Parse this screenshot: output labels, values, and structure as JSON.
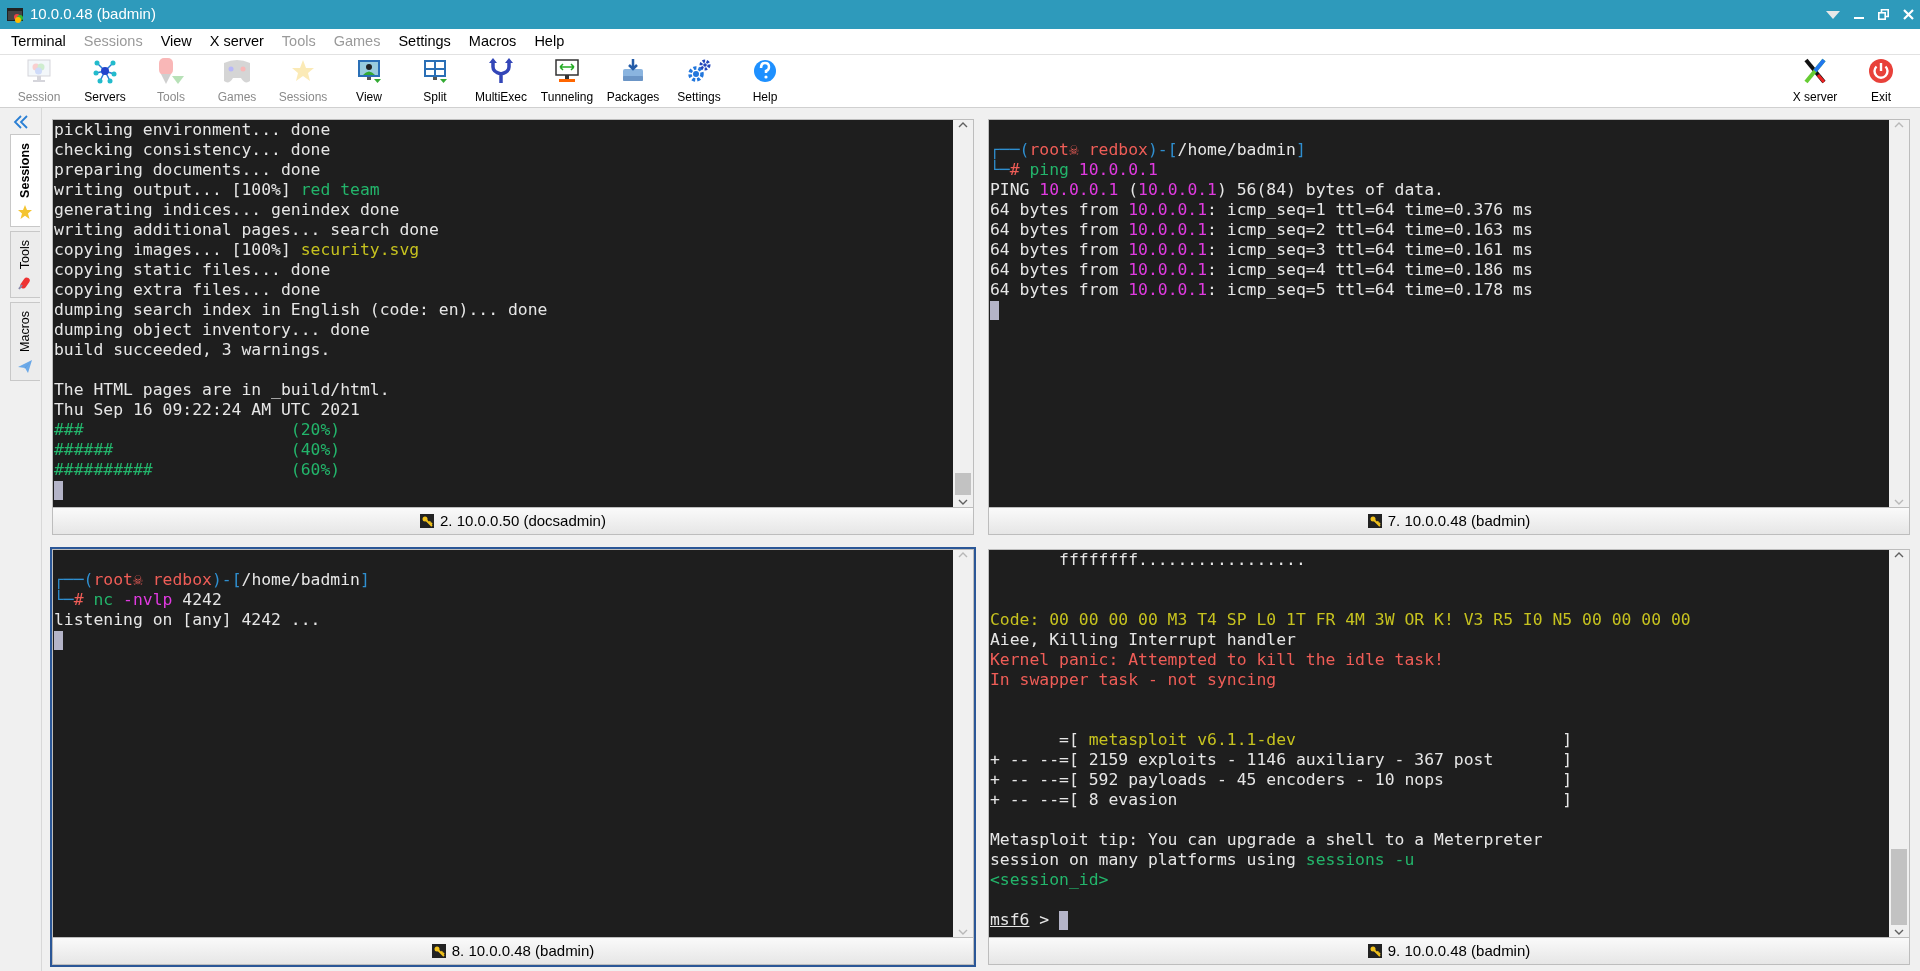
{
  "window": {
    "title": "10.0.0.48 (badmin)"
  },
  "menu": [
    {
      "label": "Terminal",
      "disabled": false
    },
    {
      "label": "Sessions",
      "disabled": true
    },
    {
      "label": "View",
      "disabled": false
    },
    {
      "label": "X server",
      "disabled": false
    },
    {
      "label": "Tools",
      "disabled": true
    },
    {
      "label": "Games",
      "disabled": true
    },
    {
      "label": "Settings",
      "disabled": false
    },
    {
      "label": "Macros",
      "disabled": false
    },
    {
      "label": "Help",
      "disabled": false
    }
  ],
  "toolbar": [
    {
      "label": "Session",
      "disabled": true
    },
    {
      "label": "Servers",
      "disabled": false
    },
    {
      "label": "Tools",
      "disabled": true
    },
    {
      "label": "Games",
      "disabled": true
    },
    {
      "label": "Sessions",
      "disabled": true
    },
    {
      "label": "View",
      "disabled": false
    },
    {
      "label": "Split",
      "disabled": false
    },
    {
      "label": "MultiExec",
      "disabled": false
    },
    {
      "label": "Tunneling",
      "disabled": false
    },
    {
      "label": "Packages",
      "disabled": false
    },
    {
      "label": "Settings",
      "disabled": false
    },
    {
      "label": "Help",
      "disabled": false
    }
  ],
  "toolbar_right": [
    {
      "label": "X server",
      "disabled": false
    },
    {
      "label": "Exit",
      "disabled": false
    }
  ],
  "sidebar": {
    "tabs": [
      {
        "label": "Sessions",
        "selected": true
      },
      {
        "label": "Tools",
        "selected": false
      },
      {
        "label": "Macros",
        "selected": false
      }
    ]
  },
  "panes": [
    {
      "caption": "2. 10.0.0.50 (docsadmin)",
      "selected": false,
      "scrollable": true,
      "lines": [
        {
          "kind": "text",
          "segments": [
            {
              "kind": "plain",
              "text": "pickling environment... done"
            }
          ]
        },
        {
          "kind": "text",
          "segments": [
            {
              "kind": "plain",
              "text": "checking consistency... done"
            }
          ]
        },
        {
          "kind": "text",
          "segments": [
            {
              "kind": "plain",
              "text": "preparing documents... done"
            }
          ]
        },
        {
          "kind": "text",
          "segments": [
            {
              "kind": "plain",
              "text": "writing output... [100%] "
            },
            {
              "kind": "green",
              "text": "red team"
            }
          ]
        },
        {
          "kind": "text",
          "segments": [
            {
              "kind": "plain",
              "text": "generating indices... genindex done"
            }
          ]
        },
        {
          "kind": "text",
          "segments": [
            {
              "kind": "plain",
              "text": "writing additional pages... search done"
            }
          ]
        },
        {
          "kind": "text",
          "segments": [
            {
              "kind": "plain",
              "text": "copying images... [100%] "
            },
            {
              "kind": "yellow",
              "text": "security.svg"
            }
          ]
        },
        {
          "kind": "text",
          "segments": [
            {
              "kind": "plain",
              "text": "copying static files... done"
            }
          ]
        },
        {
          "kind": "text",
          "segments": [
            {
              "kind": "plain",
              "text": "copying extra files... done"
            }
          ]
        },
        {
          "kind": "text",
          "segments": [
            {
              "kind": "plain",
              "text": "dumping search index in English (code: en)... done"
            }
          ]
        },
        {
          "kind": "text",
          "segments": [
            {
              "kind": "plain",
              "text": "dumping object inventory... done"
            }
          ]
        },
        {
          "kind": "text",
          "segments": [
            {
              "kind": "plain",
              "text": "build succeeded, 3 warnings."
            }
          ]
        },
        {
          "kind": "blank"
        },
        {
          "kind": "text",
          "segments": [
            {
              "kind": "plain",
              "text": "The HTML pages are in _build/html."
            }
          ]
        },
        {
          "kind": "text",
          "segments": [
            {
              "kind": "plain",
              "text": "Thu Sep 16 09:22:24 AM UTC 2021"
            }
          ]
        },
        {
          "kind": "text",
          "segments": [
            {
              "kind": "green",
              "text": "###                     (20%)"
            }
          ]
        },
        {
          "kind": "text",
          "segments": [
            {
              "kind": "green",
              "text": "######                  (40%)"
            }
          ]
        },
        {
          "kind": "text",
          "segments": [
            {
              "kind": "green",
              "text": "##########              (60%)"
            }
          ]
        },
        {
          "kind": "cursor"
        }
      ]
    },
    {
      "caption": "7. 10.0.0.48 (badmin)",
      "selected": false,
      "scrollable": false,
      "lines": [
        {
          "kind": "blank"
        },
        {
          "kind": "text",
          "segments": [
            {
              "kind": "blue",
              "text": "┌──("
            },
            {
              "kind": "red",
              "text": "root☠ redbox"
            },
            {
              "kind": "blue",
              "text": ")-["
            },
            {
              "kind": "plain",
              "text": "/home/badmin"
            },
            {
              "kind": "blue",
              "text": "]"
            }
          ]
        },
        {
          "kind": "text",
          "segments": [
            {
              "kind": "blue",
              "text": "└─"
            },
            {
              "kind": "red",
              "text": "# "
            },
            {
              "kind": "green",
              "text": "ping "
            },
            {
              "kind": "magenta",
              "text": "10.0.0.1"
            }
          ]
        },
        {
          "kind": "text",
          "segments": [
            {
              "kind": "plain",
              "text": "PING "
            },
            {
              "kind": "magenta",
              "text": "10.0.0.1"
            },
            {
              "kind": "plain",
              "text": " ("
            },
            {
              "kind": "magenta",
              "text": "10.0.0.1"
            },
            {
              "kind": "plain",
              "text": ") 56(84) bytes of data."
            }
          ]
        },
        {
          "kind": "text",
          "segments": [
            {
              "kind": "plain",
              "text": "64 bytes from "
            },
            {
              "kind": "magenta",
              "text": "10.0.0.1"
            },
            {
              "kind": "plain",
              "text": ": icmp_seq=1 ttl=64 time=0.376 ms"
            }
          ]
        },
        {
          "kind": "text",
          "segments": [
            {
              "kind": "plain",
              "text": "64 bytes from "
            },
            {
              "kind": "magenta",
              "text": "10.0.0.1"
            },
            {
              "kind": "plain",
              "text": ": icmp_seq=2 ttl=64 time=0.163 ms"
            }
          ]
        },
        {
          "kind": "text",
          "segments": [
            {
              "kind": "plain",
              "text": "64 bytes from "
            },
            {
              "kind": "magenta",
              "text": "10.0.0.1"
            },
            {
              "kind": "plain",
              "text": ": icmp_seq=3 ttl=64 time=0.161 ms"
            }
          ]
        },
        {
          "kind": "text",
          "segments": [
            {
              "kind": "plain",
              "text": "64 bytes from "
            },
            {
              "kind": "magenta",
              "text": "10.0.0.1"
            },
            {
              "kind": "plain",
              "text": ": icmp_seq=4 ttl=64 time=0.186 ms"
            }
          ]
        },
        {
          "kind": "text",
          "segments": [
            {
              "kind": "plain",
              "text": "64 bytes from "
            },
            {
              "kind": "magenta",
              "text": "10.0.0.1"
            },
            {
              "kind": "plain",
              "text": ": icmp_seq=5 ttl=64 time=0.178 ms"
            }
          ]
        },
        {
          "kind": "cursor"
        }
      ]
    },
    {
      "caption": "8. 10.0.0.48 (badmin)",
      "selected": true,
      "scrollable": false,
      "lines": [
        {
          "kind": "blank"
        },
        {
          "kind": "text",
          "segments": [
            {
              "kind": "blue",
              "text": "┌──("
            },
            {
              "kind": "red",
              "text": "root☠ redbox"
            },
            {
              "kind": "blue",
              "text": ")-["
            },
            {
              "kind": "plain",
              "text": "/home/badmin"
            },
            {
              "kind": "blue",
              "text": "]"
            }
          ]
        },
        {
          "kind": "text",
          "segments": [
            {
              "kind": "blue",
              "text": "└─"
            },
            {
              "kind": "red",
              "text": "# "
            },
            {
              "kind": "green",
              "text": "nc "
            },
            {
              "kind": "magenta",
              "text": "-nvlp "
            },
            {
              "kind": "plain",
              "text": "4242"
            }
          ]
        },
        {
          "kind": "text",
          "segments": [
            {
              "kind": "plain",
              "text": "listening on [any] 4242 ..."
            }
          ]
        },
        {
          "kind": "cursor"
        }
      ]
    },
    {
      "caption": "9. 10.0.0.48 (badmin)",
      "selected": false,
      "scrollable": true,
      "lines": [
        {
          "kind": "text",
          "segments": [
            {
              "kind": "plain",
              "text": "       ffffffff................."
            }
          ]
        },
        {
          "kind": "blank"
        },
        {
          "kind": "blank"
        },
        {
          "kind": "text",
          "segments": [
            {
              "kind": "yellow",
              "text": "Code: 00 00 00 00 M3 T4 SP L0 1T FR 4M 3W OR K! V3 R5 I0 N5 00 00 00 00"
            }
          ]
        },
        {
          "kind": "text",
          "segments": [
            {
              "kind": "plain",
              "text": "Aiee, Killing Interrupt handler"
            }
          ]
        },
        {
          "kind": "text",
          "segments": [
            {
              "kind": "red",
              "text": "Kernel panic: Attempted to kill the idle task!"
            }
          ]
        },
        {
          "kind": "text",
          "segments": [
            {
              "kind": "red",
              "text": "In swapper task - not syncing"
            }
          ]
        },
        {
          "kind": "blank"
        },
        {
          "kind": "blank"
        },
        {
          "kind": "text",
          "segments": [
            {
              "kind": "plain",
              "text": "       =[ "
            },
            {
              "kind": "yellow",
              "text": "metasploit v6.1.1-dev"
            },
            {
              "kind": "plain",
              "text": "                           ]"
            }
          ]
        },
        {
          "kind": "text",
          "segments": [
            {
              "kind": "plain",
              "text": "+ -- --=[ 2159 exploits - 1146 auxiliary - 367 post       ]"
            }
          ]
        },
        {
          "kind": "text",
          "segments": [
            {
              "kind": "plain",
              "text": "+ -- --=[ 592 payloads - 45 encoders - 10 nops            ]"
            }
          ]
        },
        {
          "kind": "text",
          "segments": [
            {
              "kind": "plain",
              "text": "+ -- --=[ 8 evasion                                       ]"
            }
          ]
        },
        {
          "kind": "blank"
        },
        {
          "kind": "text",
          "segments": [
            {
              "kind": "plain",
              "text": "Metasploit tip: You can upgrade a shell to a Meterpreter"
            }
          ]
        },
        {
          "kind": "text",
          "segments": [
            {
              "kind": "plain",
              "text": "session on many platforms using "
            },
            {
              "kind": "green",
              "text": "sessions -u"
            }
          ]
        },
        {
          "kind": "text",
          "segments": [
            {
              "kind": "green",
              "text": "<session_id>"
            }
          ]
        },
        {
          "kind": "blank"
        },
        {
          "kind": "cursor",
          "segments": [
            {
              "kind": "underline",
              "text": "msf6"
            },
            {
              "kind": "plain",
              "text": " > "
            }
          ]
        }
      ]
    }
  ]
}
